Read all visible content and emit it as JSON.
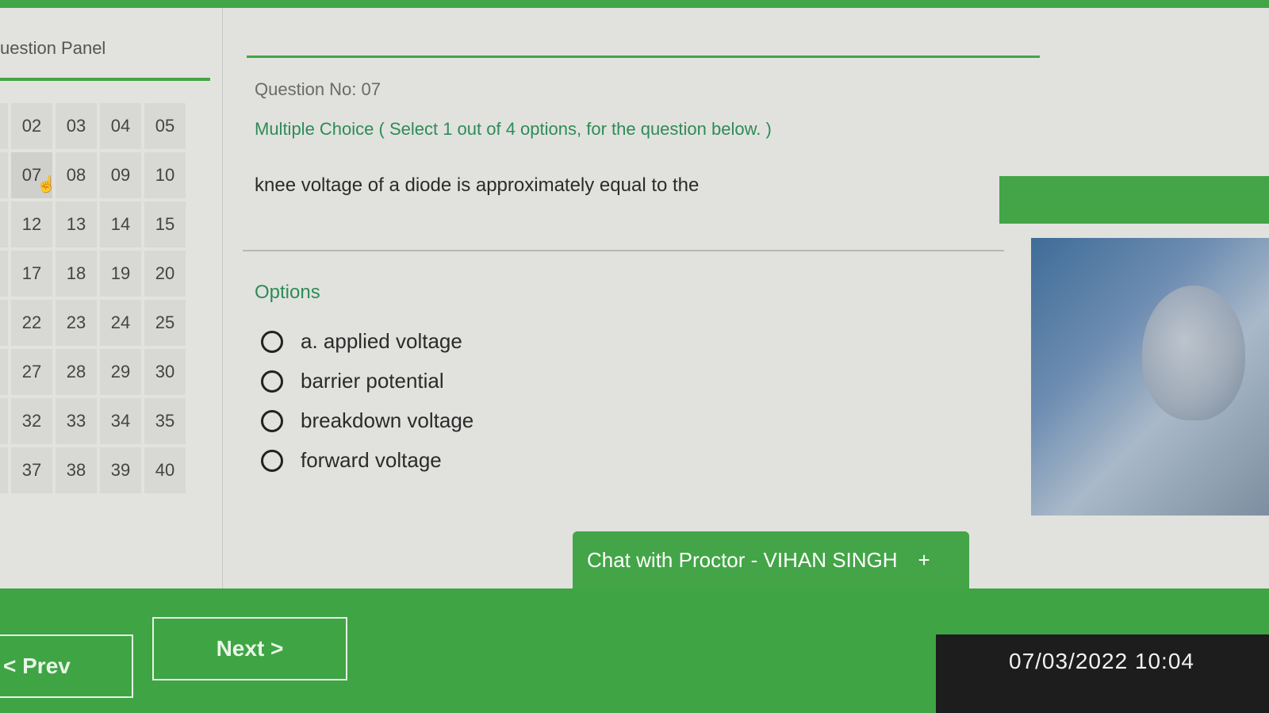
{
  "panel": {
    "title": "uestion Panel",
    "grid": [
      [
        "",
        "02",
        "03",
        "04",
        "05"
      ],
      [
        "",
        "07",
        "08",
        "09",
        "10"
      ],
      [
        "",
        "12",
        "13",
        "14",
        "15"
      ],
      [
        "",
        "17",
        "18",
        "19",
        "20"
      ],
      [
        "",
        "22",
        "23",
        "24",
        "25"
      ],
      [
        "",
        "27",
        "28",
        "29",
        "30"
      ],
      [
        "",
        "32",
        "33",
        "34",
        "35"
      ],
      [
        "",
        "37",
        "38",
        "39",
        "40"
      ]
    ]
  },
  "question": {
    "number_label": "Question No: 07",
    "type_label": "Multiple Choice ( Select 1 out of 4 options, for the question below. )",
    "text": "knee voltage of a diode is approximately equal to the",
    "options_label": "Options",
    "options": [
      {
        "text": "a. applied voltage"
      },
      {
        "text": "barrier potential"
      },
      {
        "text": "breakdown voltage"
      },
      {
        "text": "forward voltage"
      }
    ]
  },
  "chat": {
    "label": "Chat with Proctor - VIHAN SINGH",
    "plus": "+"
  },
  "nav": {
    "prev": "< Prev",
    "next": "Next >"
  },
  "overlay": {
    "timestamp": "07/03/2022 10:04"
  },
  "colors": {
    "accent": "#43a547",
    "bottom_bar": "#3fa443"
  },
  "icons": {
    "cursor": "pointer-hand-icon",
    "radio": "radio-empty-icon"
  }
}
